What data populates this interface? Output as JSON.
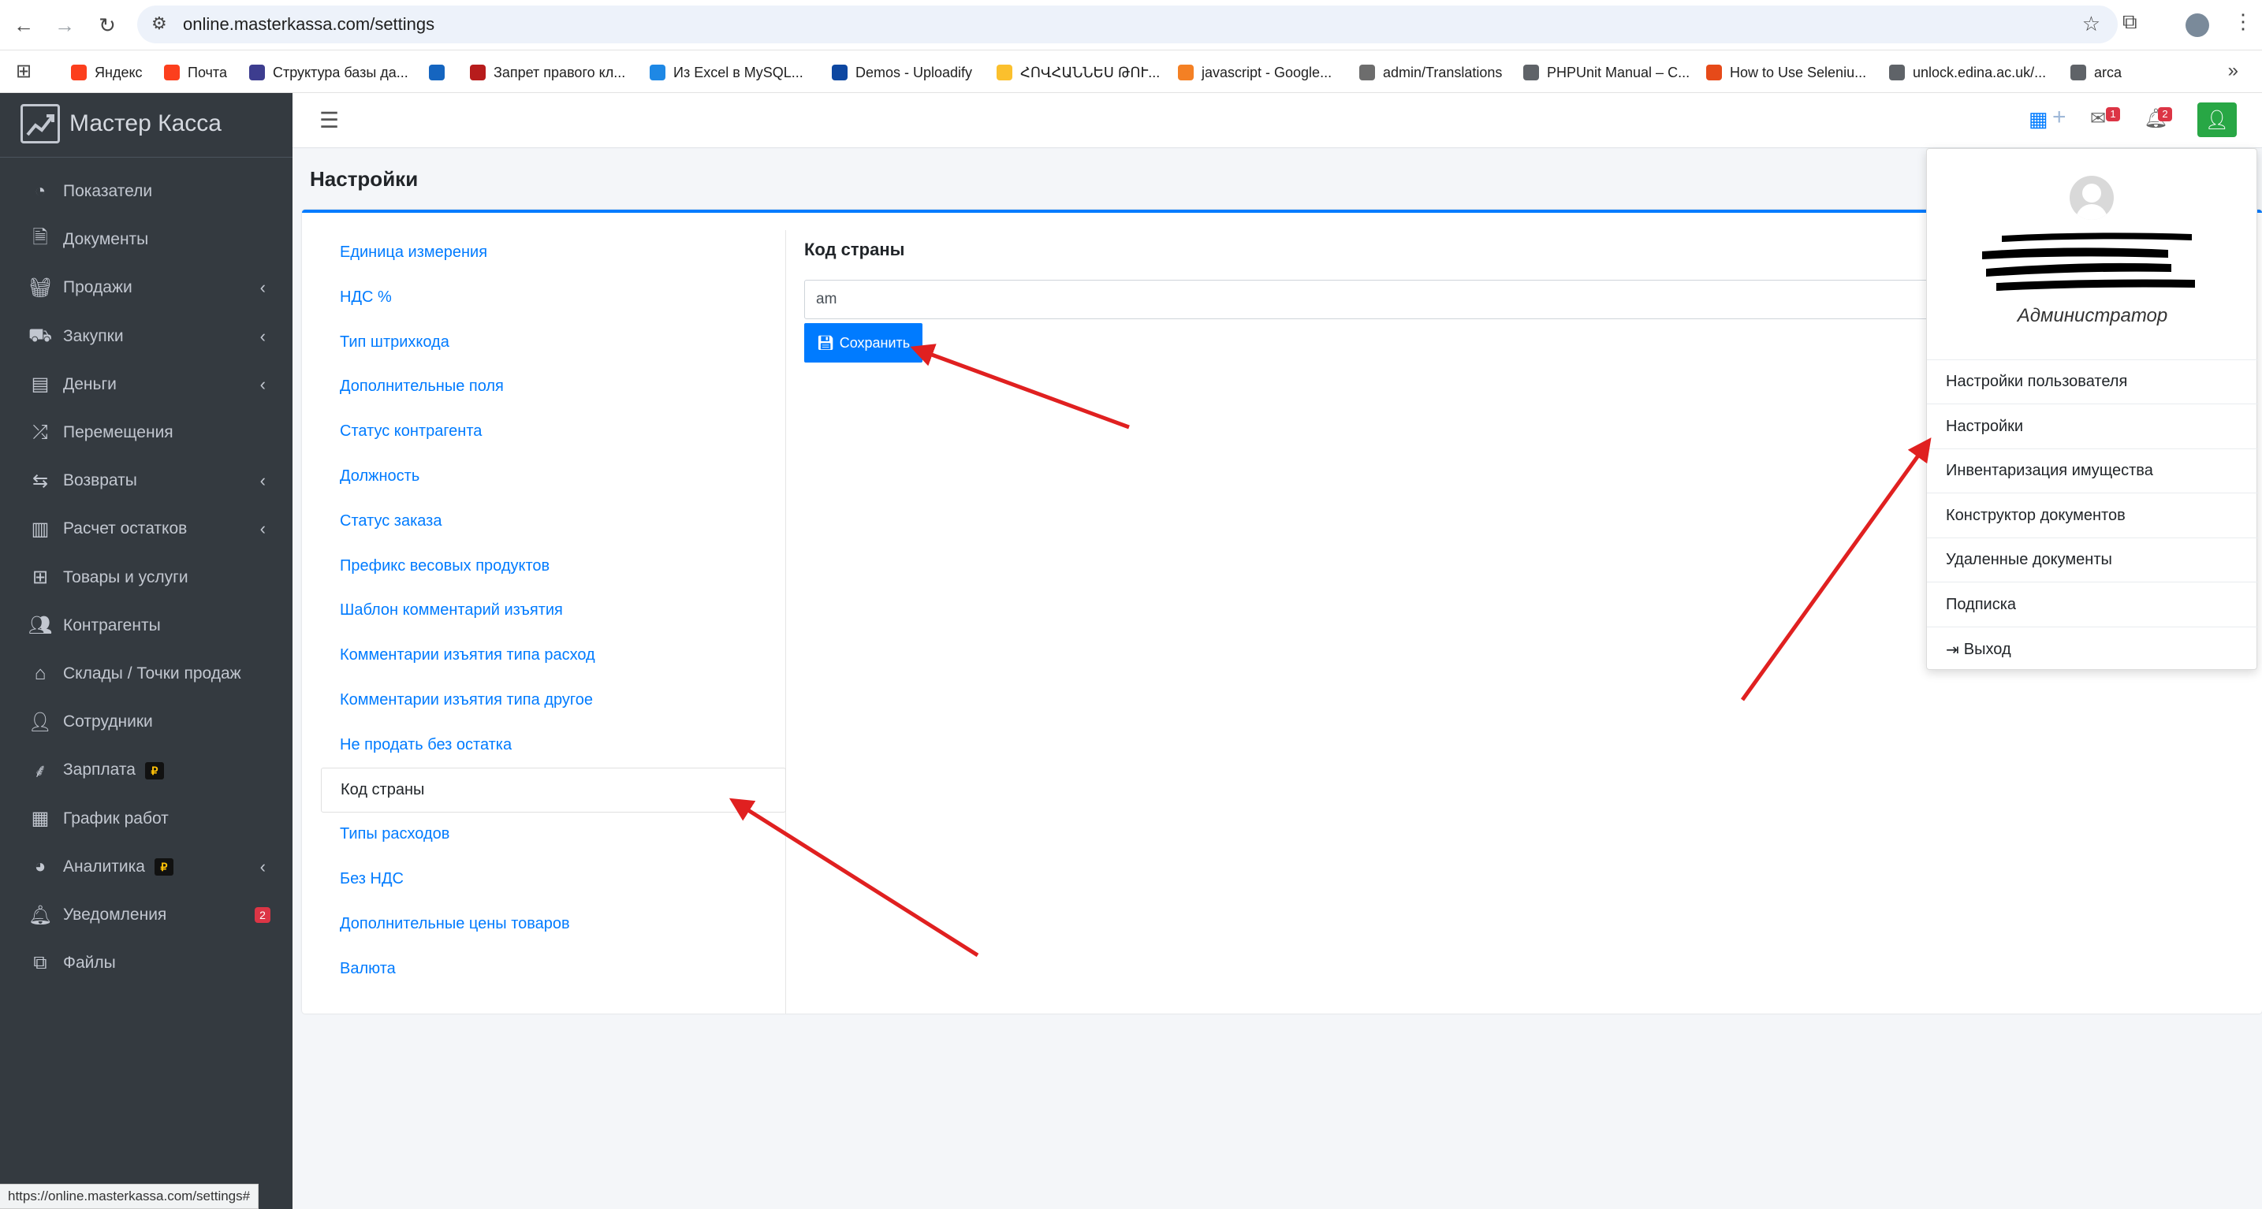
{
  "browser": {
    "url": "online.masterkassa.com/settings",
    "bookmarks": [
      {
        "label": "Яндекс",
        "color": "#fc3f1d"
      },
      {
        "label": "Почта",
        "color": "#fc3f1d"
      },
      {
        "label": "Структура базы да...",
        "color": "#3d3d8f"
      },
      {
        "label": "",
        "color": "#1565c0"
      },
      {
        "label": "Запрет правого кл...",
        "color": "#b71c1c"
      },
      {
        "label": "Из Excel в MySQL...",
        "color": "#1e88e5"
      },
      {
        "label": "Demos - Uploadify",
        "color": "#0d47a1"
      },
      {
        "label": "ՀՈՎՀԱՆՆԵՍ ԹՈՒ...",
        "color": "#fbc02d"
      },
      {
        "label": "javascript - Google...",
        "color": "#f48024"
      },
      {
        "label": "admin/Translations",
        "color": "#6d6d6d"
      },
      {
        "label": "PHPUnit Manual – C...",
        "color": "#5f6368"
      },
      {
        "label": "How to Use Seleniu...",
        "color": "#e64a19"
      },
      {
        "label": "unlock.edina.ac.uk/...",
        "color": "#5f6368"
      },
      {
        "label": "arca",
        "color": "#5f6368"
      }
    ],
    "status_url": "https://online.masterkassa.com/settings#"
  },
  "brand": {
    "name": "Мастер Касса"
  },
  "sidebar": {
    "items": [
      {
        "label": "Показатели",
        "icon": "dashboard-icon",
        "chevron": false
      },
      {
        "label": "Документы",
        "icon": "document-icon",
        "chevron": false
      },
      {
        "label": "Продажи",
        "icon": "basket-icon",
        "chevron": true
      },
      {
        "label": "Закупки",
        "icon": "dolly-icon",
        "chevron": true
      },
      {
        "label": "Деньги",
        "icon": "wallet-icon",
        "chevron": true
      },
      {
        "label": "Перемещения",
        "icon": "shuffle-icon",
        "chevron": false
      },
      {
        "label": "Возвраты",
        "icon": "retweet-icon",
        "chevron": true
      },
      {
        "label": "Расчет остатков",
        "icon": "bar-chart-icon",
        "chevron": true
      },
      {
        "label": "Товары и услуги",
        "icon": "grid-icon",
        "chevron": false
      },
      {
        "label": "Контрагенты",
        "icon": "users-icon",
        "chevron": false
      },
      {
        "label": "Склады / Точки продаж",
        "icon": "store-icon",
        "chevron": false
      },
      {
        "label": "Сотрудники",
        "icon": "user-icon",
        "chevron": false
      },
      {
        "label": "Зарплата",
        "icon": "tree-icon",
        "chevron": false,
        "badge": "₽"
      },
      {
        "label": "График работ",
        "icon": "calendar-icon",
        "chevron": false
      },
      {
        "label": "Аналитика",
        "icon": "pie-chart-icon",
        "chevron": true,
        "badge": "₽"
      },
      {
        "label": "Уведомления",
        "icon": "bell-icon",
        "chevron": false,
        "count": "2"
      },
      {
        "label": "Файлы",
        "icon": "files-icon",
        "chevron": false
      }
    ]
  },
  "navbar": {
    "mail_count": "1",
    "bell_count": "2"
  },
  "page": {
    "title": "Настройки"
  },
  "settings_list": [
    "Единица измерения",
    "НДС %",
    "Тип штрихкода",
    "Дополнительные поля",
    "Статус контрагента",
    "Должность",
    "Статус заказа",
    "Префикс весовых продуктов",
    "Шаблон комментарий изъятия",
    "Комментарии изъятия типа расход",
    "Комментарии изъятия типа другое",
    "Не продать без остатка",
    "Код страны",
    "Типы расходов",
    "Без НДС",
    "Дополнительные цены товаров",
    "Валюта"
  ],
  "active_setting_index": 12,
  "form": {
    "label": "Код страны",
    "value": "am",
    "save_label": "Сохранить"
  },
  "user_menu": {
    "role": "Администратор",
    "items": [
      "Настройки пользователя",
      "Настройки",
      "Инвентаризация имущества",
      "Конструктор документов",
      "Удаленные документы",
      "Подписка",
      "Выход"
    ]
  },
  "colors": {
    "sidebar_bg": "#343a40",
    "link": "#007bff",
    "save_button": "#007bff",
    "user_button": "#28a745",
    "badge": "#dc3545",
    "arrow": "#e02020"
  }
}
